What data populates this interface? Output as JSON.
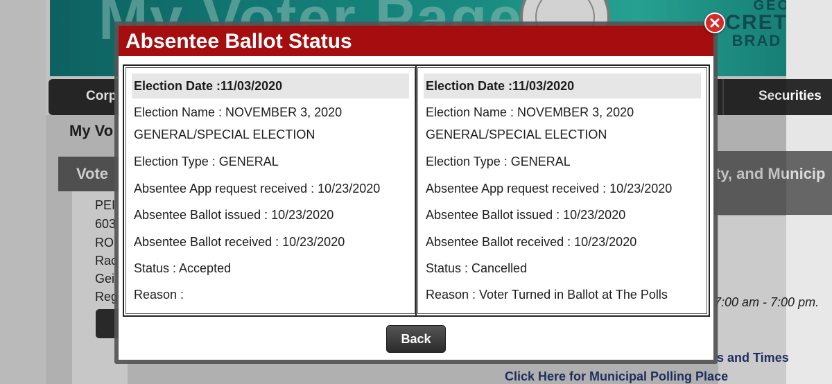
{
  "background": {
    "banner_title": "My Voter Page",
    "sos_line1": "GEORGIA",
    "sos_line2": "CRETARY",
    "sos_line3": "BRAD RAFF",
    "nav": {
      "item1": "Corp",
      "item2": "Securities"
    },
    "heading": "My Vo",
    "voter_section": "Vote",
    "left_lines": [
      "PEI",
      "603",
      "RO",
      "Rac",
      "Gei",
      "Reg"
    ],
    "right_header": "ty, and Municip",
    "hours": "7:00 am - 7:00 pm.",
    "link1": "s and Times",
    "link2": "Click Here for Municipal Polling Place"
  },
  "modal": {
    "title": "Absentee Ballot Status",
    "back_label": "Back",
    "columns": [
      {
        "election_date": "Election Date :11/03/2020",
        "election_name_1": "Election Name : NOVEMBER 3, 2020",
        "election_name_2": "GENERAL/SPECIAL ELECTION",
        "election_type": "Election Type : GENERAL",
        "app_received": "Absentee App request received : 10/23/2020",
        "ballot_issued": "Absentee Ballot issued : 10/23/2020",
        "ballot_received": "Absentee Ballot received : 10/23/2020",
        "status": "Status : Accepted",
        "reason": "Reason :"
      },
      {
        "election_date": "Election Date :11/03/2020",
        "election_name_1": "Election Name : NOVEMBER 3, 2020",
        "election_name_2": "GENERAL/SPECIAL ELECTION",
        "election_type": "Election Type : GENERAL",
        "app_received": "Absentee App request received : 10/23/2020",
        "ballot_issued": "Absentee Ballot issued : 10/23/2020",
        "ballot_received": "Absentee Ballot received : 10/23/2020",
        "status": "Status : Cancelled",
        "reason": "Reason : Voter Turned in Ballot at The Polls"
      }
    ]
  },
  "colors": {
    "header_red": "#a50d0e",
    "close_red": "#d42a2a",
    "banner_teal": "#1d9f92"
  }
}
